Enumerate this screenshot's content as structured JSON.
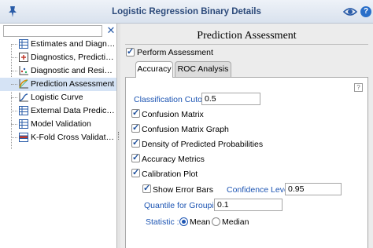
{
  "window": {
    "title": "Logistic Regression Binary Details"
  },
  "search": {
    "placeholder": "",
    "value": ""
  },
  "sidebar": {
    "items": [
      {
        "label": "Estimates and Diagnostics",
        "icon": "table-icon",
        "selected": false
      },
      {
        "label": "Diagnostics, Predictions, ...",
        "icon": "plus-box-icon",
        "selected": false
      },
      {
        "label": "Diagnostic and Residual ...",
        "icon": "scatter-plot-icon",
        "selected": false
      },
      {
        "label": "Prediction Assessment",
        "icon": "curve-chart-icon",
        "selected": true
      },
      {
        "label": "Logistic Curve",
        "icon": "s-curve-icon",
        "selected": false
      },
      {
        "label": "External Data Predicted ...",
        "icon": "table-icon",
        "selected": false
      },
      {
        "label": "Model Validation",
        "icon": "table-icon",
        "selected": false
      },
      {
        "label": "K-Fold Cross Validation",
        "icon": "kfold-icon",
        "selected": false
      }
    ]
  },
  "main": {
    "heading": "Prediction Assessment",
    "perform_assessment": {
      "label": "Perform Assessment",
      "checked": true
    },
    "tabs": [
      {
        "label": "Accuracy",
        "active": true
      },
      {
        "label": "ROC Analysis",
        "active": false
      }
    ],
    "help_glyph": "?",
    "classification_cutoff": {
      "label": "Classification Cutoff :",
      "value": "0.5"
    },
    "options": [
      {
        "label": "Confusion Matrix",
        "checked": true
      },
      {
        "label": "Confusion Matrix Graph",
        "checked": true
      },
      {
        "label": "Density of Predicted Probabilities",
        "checked": true
      },
      {
        "label": "Accuracy Metrics",
        "checked": true
      },
      {
        "label": "Calibration Plot",
        "checked": true
      }
    ],
    "show_error_bars": {
      "label": "Show Error Bars",
      "checked": true
    },
    "confidence_level": {
      "label": "Confidence Level :",
      "value": "0.95"
    },
    "quantile_grouping": {
      "label": "Quantile for Grouping :",
      "value": "0.1"
    },
    "statistic": {
      "label": "Statistic :",
      "options": [
        {
          "label": "Mean",
          "selected": true
        },
        {
          "label": "Median",
          "selected": false
        }
      ]
    }
  },
  "colors": {
    "accent": "#1d55b3",
    "title": "#2c4a7a",
    "selection": "#d5e3f5"
  }
}
